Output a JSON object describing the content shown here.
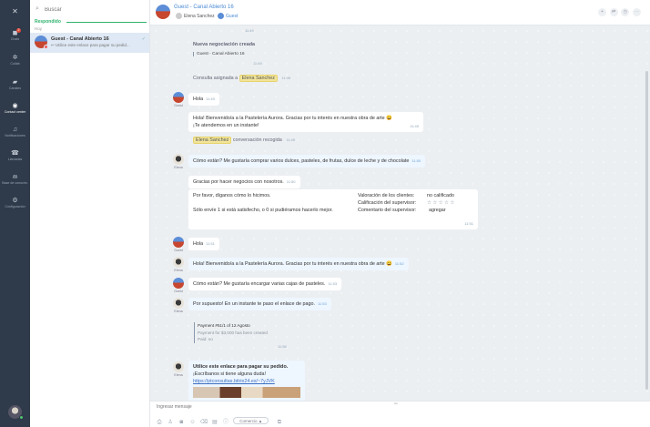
{
  "rail": {
    "close_icon": "close-icon",
    "items": [
      {
        "label": "Chats",
        "icon": "chat-icon",
        "badge": "2"
      },
      {
        "label": "Collab",
        "icon": "collab-icon"
      },
      {
        "label": "Canales",
        "icon": "channels-icon"
      },
      {
        "label": "Contact center",
        "icon": "contact-center-icon",
        "active": true
      },
      {
        "label": "Notificaciones",
        "icon": "bell-icon"
      },
      {
        "label": "Llamadas",
        "icon": "phone-icon"
      },
      {
        "label": "Base de conocim.",
        "icon": "knowledge-icon"
      },
      {
        "label": "Configuración",
        "icon": "gear-icon"
      }
    ]
  },
  "sidebar": {
    "search_placeholder": "Buscar",
    "section_title": "Respondido",
    "section_sub": "Hoy",
    "chat": {
      "name": "Guest - Canal Abierto 16",
      "preview": "Utilice este enlace para pagar su pedid..."
    }
  },
  "header": {
    "title": "Guest - Canal Abierto 16",
    "participant1": "Elena Sanchez",
    "participant2": "Guest"
  },
  "messages": {
    "sys_time_top": "11:49",
    "new_deal_title": "Nueva negociación creada",
    "new_deal_link": "Guest - Canal Abierto 16",
    "new_deal_time": "11:49",
    "assigned_prefix": "Consulta asignada a",
    "assigned_name": "Elena Sanchez",
    "assigned_time": "11:49",
    "m1": {
      "text": "Hola",
      "time": "11:49",
      "author": "Guest"
    },
    "m2": {
      "line1": "Hola! Bienvenido/a a la Pastelería Aurora. Gracias por tu interés en nuestra obra de arte 😄",
      "line2": "¡Te atendemos en un instante!",
      "time": "11:49"
    },
    "collected_name": "Elena Sanchez",
    "collected_text": "conversación recogida",
    "collected_time": "11:49",
    "m3": {
      "text": "Cómo están? Me gustaría comprar varios dulces, pasteles, de frutas, dulce de leche y de chocolate",
      "time": "11:50",
      "author": "Elena"
    },
    "m4": {
      "text": "Gracias por hacer negocios con nosotros.",
      "time": "11:50"
    },
    "m5": {
      "left1": "Por favor, díganos cómo lo hicimos.",
      "left2": "Sólo envíe 1 si está satisfecho, o 0 si pudiéramos hacerlo mejor.",
      "r1_label": "Valoración de los clientes:",
      "r1_value": "no calificado",
      "r2_label": "Calificación del supervisor:",
      "r2_value": "☆ ☆ ☆ ☆ ☆",
      "r3_label": "Comentario del supervisor:",
      "r3_value": "agregar",
      "time": "11:51"
    },
    "m6": {
      "text": "Hola",
      "time": "11:51",
      "author": "Guest"
    },
    "m7": {
      "text": "Hola! Bienvenido/a a la Pastelería Aurora. Gracias por tu interés en nuestra obra de arte 😄",
      "time": "11:52",
      "author": "Elena"
    },
    "m8": {
      "text": "Cómo están? Me gustaría encargar varias cajas de pasteles.",
      "time": "11:53",
      "author": "Guest"
    },
    "m9": {
      "text": "Por supuesto! En un instante te paso el enlace de pago.",
      "time": "11:53",
      "author": "Elena"
    },
    "payment": {
      "title": "Payment #51/1 of 12 Agosto",
      "line1": "Payment for $3,000 has been created",
      "line2": "Paid: no",
      "time": "11:56"
    },
    "m10": {
      "line1": "Utilice este enlace para pagar su pedido.",
      "line2": "¡Escríbanos si tiene alguna duda!",
      "link": "https://ptconsultas.bitrix24.es/~7yJVK",
      "author": "Elena"
    }
  },
  "composer": {
    "placeholder": "Ingresar mensaje",
    "pill_label": "Comercio ▲"
  }
}
